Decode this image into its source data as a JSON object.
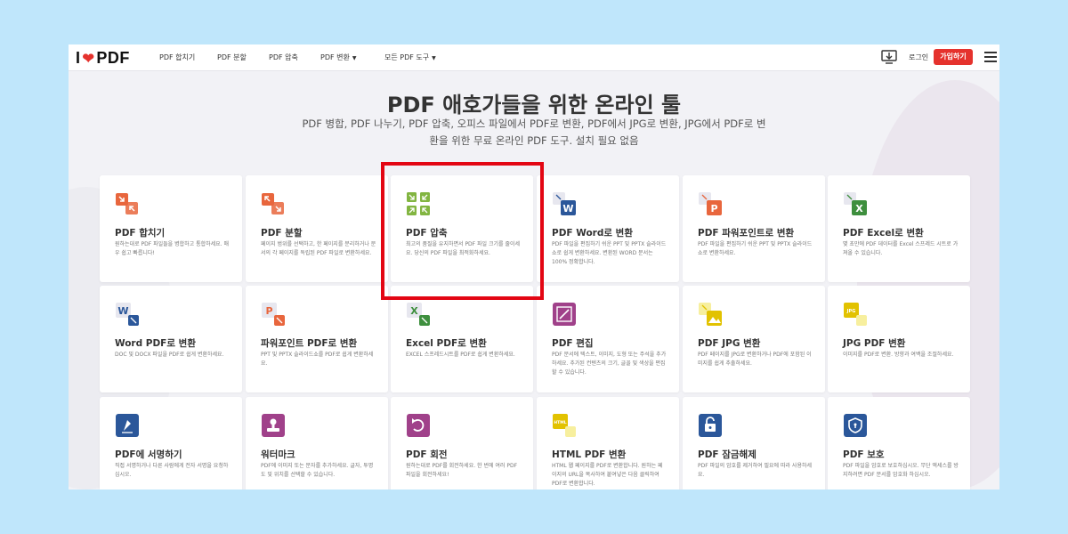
{
  "brand": {
    "logo_left": "I",
    "logo_right": "PDF",
    "accent": "#e5322d"
  },
  "nav": {
    "merge": "PDF 합치기",
    "split": "PDF 분할",
    "compress": "PDF 압축",
    "convert": "PDF 변환",
    "all_tools": "모든 PDF 도구",
    "login": "로그인",
    "signup": "가입하기"
  },
  "hero": {
    "title": "PDF 애호가들을 위한 온라인 툴",
    "subtitle_line1": "PDF 병합, PDF 나누기, PDF 압축, 오피스 파일에서 PDF로 변환, PDF에서 JPG로 변환, JPG에서 PDF로 변",
    "subtitle_line2": "환을 위한 무료 온라인 PDF 도구. 설치 필요 없음"
  },
  "tools": [
    {
      "title": "PDF 합치기",
      "desc": "원하는대로 PDF 파일들을 병합하고 통합하세요. 매우 쉽고 빠릅니다!",
      "icon": "merge-icon",
      "color": "#e8663d"
    },
    {
      "title": "PDF 분할",
      "desc": "페이지 범위를 선택하고, 한 페이지를 분리하거나 문서의 각 페이지를 독립된 PDF 파일로 변환하세요.",
      "icon": "split-icon",
      "color": "#e8663d"
    },
    {
      "title": "PDF 압축",
      "desc": "최고의 품질을 유지하면서 PDF 파일 크기를 줄이세요. 당신의 PDF 파일을 최적화하세요.",
      "icon": "compress-icon",
      "color": "#82b541"
    },
    {
      "title": "PDF Word로 변환",
      "desc": "PDF 파일을 편집하기 쉬운 PPT 및 PPTX 슬라이드쇼로 쉽게 변환하세요. 변환된 WORD 문서는 100% 정확합니다.",
      "icon": "word-icon",
      "color": "#2b579a"
    },
    {
      "title": "PDF 파워포인트로 변환",
      "desc": "PDF 파일을 편집하기 쉬운 PPT 및 PPTX 슬라이드쇼로 변환하세요.",
      "icon": "powerpoint-icon",
      "color": "#e8663d"
    },
    {
      "title": "PDF Excel로 변환",
      "desc": "몇 초만에 PDF 데이터를 Excel 스프레드 시트로 가져올 수 있습니다.",
      "icon": "excel-icon",
      "color": "#3e8f3e"
    },
    {
      "title": "Word PDF로 변환",
      "desc": "DOC 및 DOCX 파일을 PDF로 쉽게 변환하세요.",
      "icon": "word-to-pdf-icon",
      "color": "#2b579a"
    },
    {
      "title": "파워포인트 PDF로 변환",
      "desc": "PPT 및 PPTX 슬라이드쇼를 PDF로 쉽게 변환하세요.",
      "icon": "powerpoint-to-pdf-icon",
      "color": "#e8663d"
    },
    {
      "title": "Excel PDF로 변환",
      "desc": "EXCEL 스프레드시트를 PDF로 쉽게 변환하세요.",
      "icon": "excel-to-pdf-icon",
      "color": "#3e8f3e"
    },
    {
      "title": "PDF 편집",
      "desc": "PDF 문서에 텍스트, 이미지, 도형 또는 주석을 추가하세요. 추가된 컨텐츠의 크기, 글꼴 및 색상을 편집할 수 있습니다.",
      "icon": "edit-icon",
      "color": "#a0418a"
    },
    {
      "title": "PDF JPG 변환",
      "desc": "PDF 페이지를 JPG로 변환하거나 PDF에 포함된 이미지를 쉽게 추출하세요.",
      "icon": "pdf-to-jpg-icon",
      "color": "#e2c200"
    },
    {
      "title": "JPG PDF 변환",
      "desc": "이미지를 PDF로 변환. 방향과 여백을 조절하세요.",
      "icon": "jpg-to-pdf-icon",
      "color": "#e2c200"
    },
    {
      "title": "PDF에 서명하기",
      "desc": "직접 서명하거나 다른 사람에게 전자 서명을 요청하십시오.",
      "icon": "sign-icon",
      "color": "#2b579a"
    },
    {
      "title": "워터마크",
      "desc": "PDF에 이미지 또는 문자를 추가하세요. 글자, 투명도 및 위치를 선택할 수 있습니다.",
      "icon": "watermark-icon",
      "color": "#a0418a"
    },
    {
      "title": "PDF 회전",
      "desc": "원하는대로 PDF를 회전하세요. 한 번에 여러 PDF 파일을 회전하세요!",
      "icon": "rotate-icon",
      "color": "#a0418a"
    },
    {
      "title": "HTML PDF 변환",
      "desc": "HTML 웹 페이지를 PDF로 변환합니다. 원하는 페이지의 URL을 복사하여 붙여넣은 다음 클릭하여 PDF로 변환합니다.",
      "icon": "html-icon",
      "color": "#e2c200"
    },
    {
      "title": "PDF 잠금해제",
      "desc": "PDF 파일의 암호를 제거하여 필요에 따라 사용하세요.",
      "icon": "unlock-icon",
      "color": "#2b579a"
    },
    {
      "title": "PDF 보호",
      "desc": "PDF 파일을 암호로 보호하십시오. 무단 액세스를 방지하려면 PDF 문서를 암호화 하십시오.",
      "icon": "protect-icon",
      "color": "#2b579a"
    }
  ]
}
